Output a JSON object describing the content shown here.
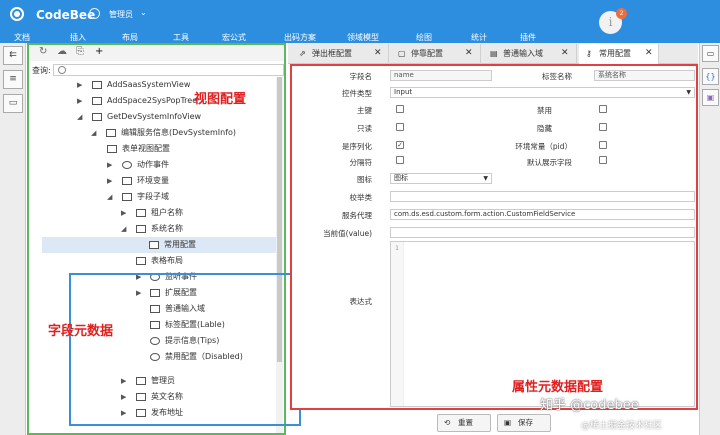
{
  "app": {
    "name": "CodeBee",
    "user": "管理员",
    "notify_icon": "i",
    "notify_count": "2"
  },
  "menu": [
    "文档",
    "插入",
    "布局",
    "工具",
    "宏公式",
    "出码方案",
    "领域模型",
    "绘图",
    "统计",
    "插件"
  ],
  "tree": {
    "search_label": "查询:",
    "items": [
      {
        "label": "AddSaasSystemView"
      },
      {
        "label": "AddSpace2SysPopTree"
      },
      {
        "label": "GetDevSystemInfoView"
      },
      {
        "label": "编辑服务信息(DevSystemInfo)"
      },
      {
        "label": "表单视图配置"
      },
      {
        "label": "动作事件"
      },
      {
        "label": "环境变量"
      },
      {
        "label": "字段子域"
      },
      {
        "label": "租户名称"
      },
      {
        "label": "系统名称"
      },
      {
        "label": "常用配置"
      },
      {
        "label": "表格布局"
      },
      {
        "label": "监听事件"
      },
      {
        "label": "扩展配置"
      },
      {
        "label": "普通输入域"
      },
      {
        "label": "标签配置(Lable)"
      },
      {
        "label": "提示信息(Tips)"
      },
      {
        "label": "禁用配置（Disabled)"
      },
      {
        "label": "管理员"
      },
      {
        "label": "英文名称"
      },
      {
        "label": "发布地址"
      }
    ]
  },
  "annotations": {
    "view_config": "视图配置",
    "field_meta": "字段元数据",
    "attr_meta": "属性元数据配置"
  },
  "tabs": [
    {
      "label": "弹出框配置",
      "close": "✕"
    },
    {
      "label": "停靠配置",
      "close": "✕"
    },
    {
      "label": "普通输入域",
      "close": "✕"
    },
    {
      "label": "常用配置",
      "close": "✕"
    }
  ],
  "form": {
    "field_name_label": "字段名",
    "field_name_value": "name",
    "tag_name_label": "标签名称",
    "tag_name_value": "系统名称",
    "control_type_label": "控件类型",
    "control_type_value": "Input",
    "primary_key_label": "主键",
    "disabled_label": "禁用",
    "readonly_label": "只读",
    "hidden_label": "隐藏",
    "serialize_label": "是序列化",
    "serialize_checked": "✓",
    "env_var_label": "环境常量（pid）",
    "delimiter_label": "分隔符",
    "show_default_label": "默认展示字段",
    "icon_label": "图标",
    "icon_value": "图标",
    "validator_label": "校举类",
    "validator_value": "",
    "service_proxy_label": "服务代理",
    "service_proxy_value": "com.ds.esd.custom.form.action.CustomFieldService",
    "current_value_label": "当前值(value)",
    "current_value_value": "",
    "expression_label": "表达式",
    "line_number": "1"
  },
  "buttons": {
    "reset": "重置",
    "save": "保存"
  },
  "watermark": {
    "line1": "知乎 @codebee",
    "line2": "@稀土掘金技术社区"
  }
}
